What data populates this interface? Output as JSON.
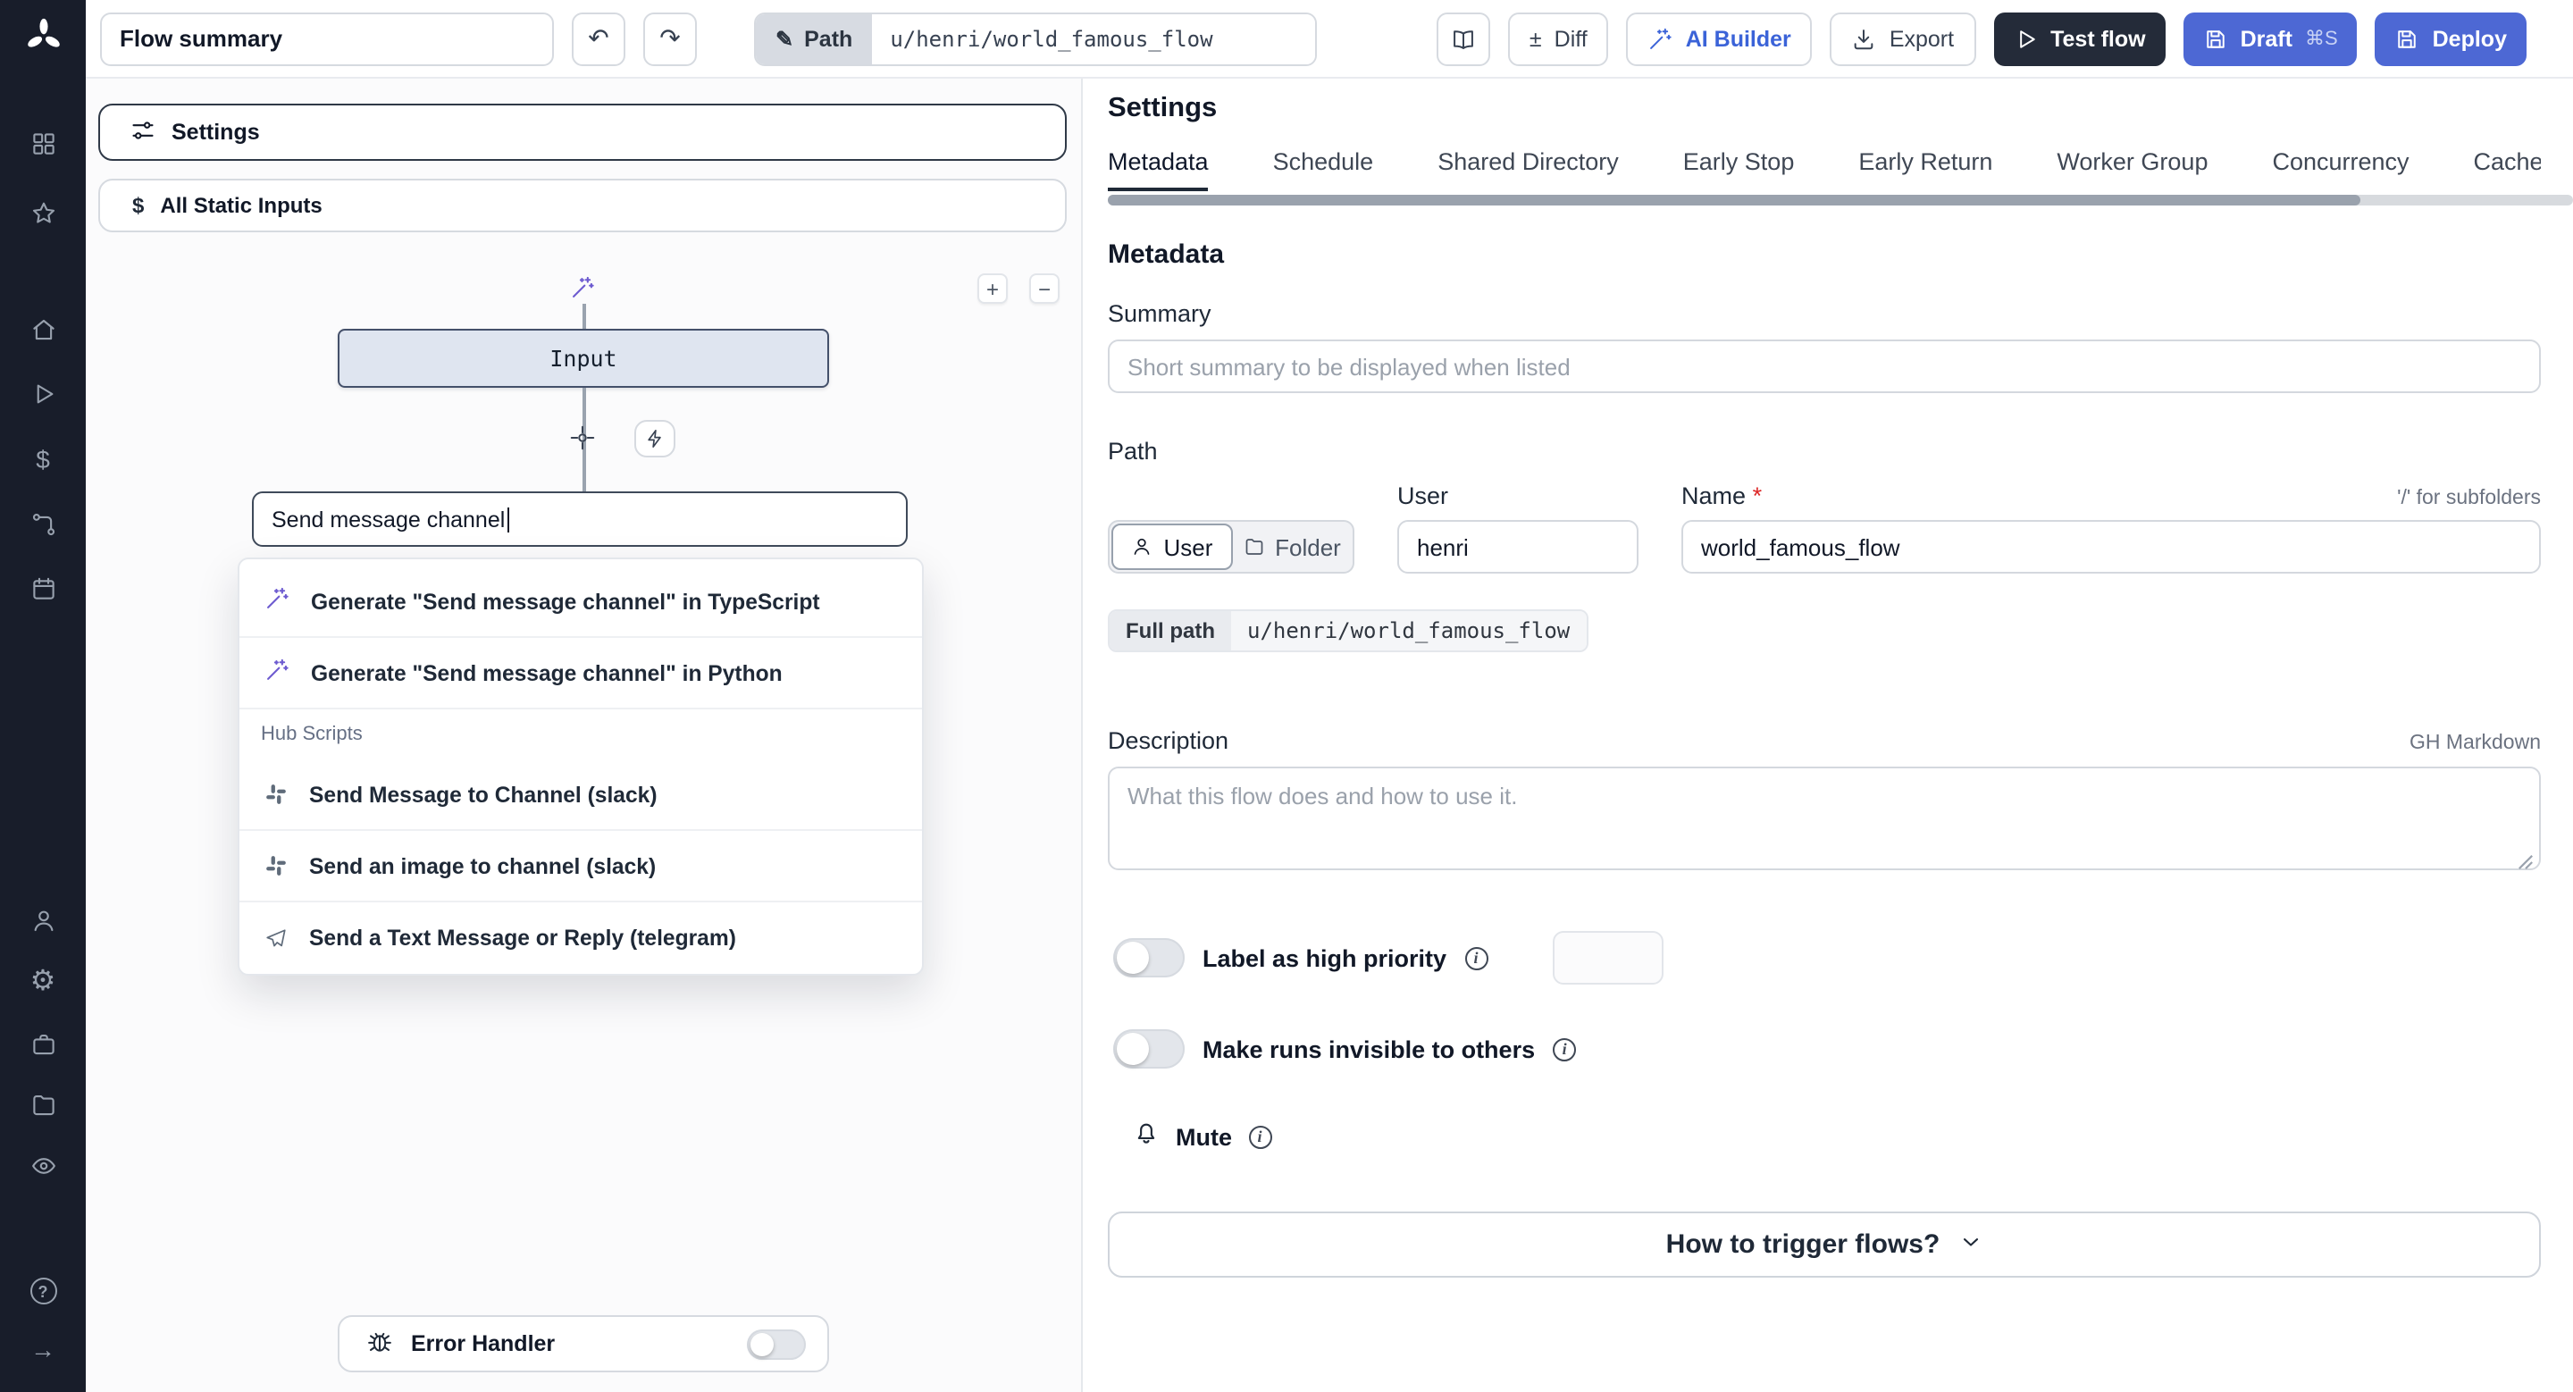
{
  "colors": {
    "accent_blue": "#4d68d4",
    "dark_button": "#242b39",
    "sidebar_bg": "#181d2a"
  },
  "glyphs": {
    "undo": "↶",
    "redo": "↷",
    "pencil": "✎",
    "diff": "±",
    "zoom_in": "+",
    "zoom_out": "−",
    "dollar": "$",
    "help": "?",
    "arrow_right": "→",
    "gear": "⚙",
    "info": "i"
  },
  "sidebar": {
    "icon_names": [
      "windmill-logo",
      "apps-icon",
      "favorites-icon",
      "home-icon",
      "runs-icon",
      "variables-icon",
      "flows-icon",
      "schedules-icon",
      "user-icon",
      "settings-icon",
      "workers-icon",
      "folders-icon",
      "audit-logs-icon",
      "help-icon",
      "collapse-icon"
    ]
  },
  "toolbar": {
    "summary_value": "Flow summary",
    "path_label": "Path",
    "path_value": "u/henri/world_famous_flow",
    "diff_label": "Diff",
    "ai_builder_label": "AI Builder",
    "export_label": "Export",
    "test_flow_label": "Test flow",
    "draft_label": "Draft",
    "draft_shortcut": "⌘S",
    "deploy_label": "Deploy"
  },
  "flow_panel": {
    "settings_label": "Settings",
    "static_inputs_label": "All Static Inputs",
    "input_node_label": "Input",
    "search_value": "Send message channel",
    "dropdown": {
      "generate": [
        {
          "label": "Generate \"Send message channel\" in TypeScript"
        },
        {
          "label": "Generate \"Send message channel\" in Python"
        }
      ],
      "hub_header": "Hub Scripts",
      "hub_items": [
        {
          "label": "Send Message to Channel (slack)",
          "icon": "slack"
        },
        {
          "label": "Send an image to channel (slack)",
          "icon": "slack"
        },
        {
          "label": "Send a Text Message or Reply (telegram)",
          "icon": "telegram"
        }
      ]
    },
    "error_handler_label": "Error Handler"
  },
  "settings_panel": {
    "title": "Settings",
    "active_tab": "Metadata",
    "tabs": [
      "Metadata",
      "Schedule",
      "Shared Directory",
      "Early Stop",
      "Early Return",
      "Worker Group",
      "Concurrency",
      "Cache"
    ],
    "metadata": {
      "heading": "Metadata",
      "summary_label": "Summary",
      "summary_placeholder": "Short summary to be displayed when listed",
      "path_label": "Path",
      "user_toggle": "User",
      "folder_toggle": "Folder",
      "user_label": "User",
      "user_value": "henri",
      "name_label": "Name",
      "name_required": "*",
      "subfolder_hint": "'/' for subfolders",
      "name_value": "world_famous_flow",
      "full_path_label": "Full path",
      "full_path_value": "u/henri/world_famous_flow",
      "description_label": "Description",
      "markdown_hint": "GH Markdown",
      "description_placeholder": "What this flow does and how to use it.",
      "high_priority_label": "Label as high priority",
      "invisible_label": "Make runs invisible to others",
      "mute_label": "Mute",
      "trigger_label": "How to trigger flows?"
    }
  }
}
